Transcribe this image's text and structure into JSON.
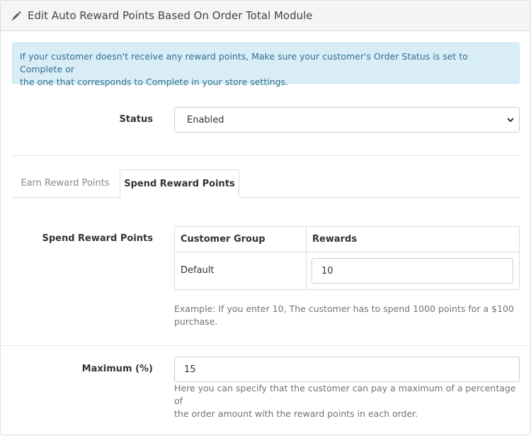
{
  "header": {
    "title": "Edit Auto Reward Points Based On Order Total Module",
    "icon": "pencil-icon"
  },
  "alert": {
    "line1": "If your customer doesn't receive any reward points, Make sure your customer's Order Status is set to Complete or",
    "line2": "the one that corresponds to Complete in your store settings."
  },
  "status": {
    "label": "Status",
    "selected": "Enabled"
  },
  "tabs": [
    {
      "label": "Earn Reward Points",
      "active": false
    },
    {
      "label": "Spend Reward Points",
      "active": true
    }
  ],
  "spend": {
    "label": "Spend Reward Points",
    "columns": [
      "Customer Group",
      "Rewards"
    ],
    "rows": [
      {
        "group": "Default",
        "rewards": "10"
      }
    ],
    "help_line1": "Example: If you enter 10, The customer has to spend 1000 points for a $100",
    "help_line2": "purchase."
  },
  "maximum": {
    "label": "Maximum (%)",
    "value": "15",
    "help_line1": "Here you can specify that the customer can pay a maximum of a percentage of",
    "help_line2": "the order amount with the reward points in each order."
  },
  "colors": {
    "alert_bg": "#d9edf7",
    "alert_text": "#31708f",
    "heading_bg": "#f5f5f5"
  }
}
